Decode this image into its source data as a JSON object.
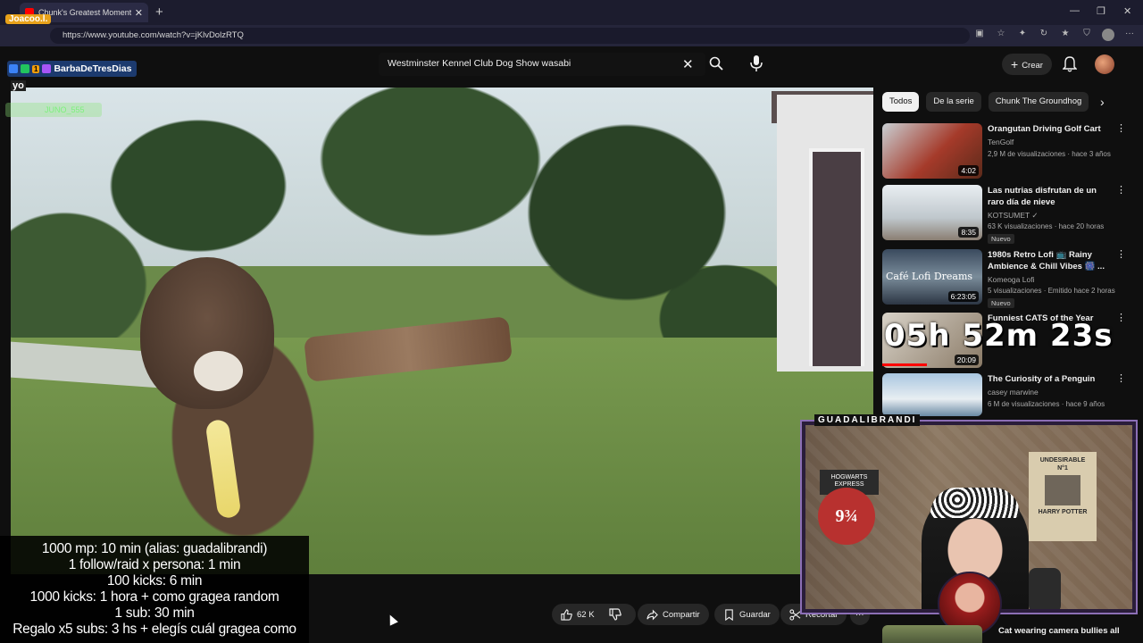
{
  "browser": {
    "tab_title": "Chunk's Greatest Moments Of",
    "tab_close": "✕",
    "new_tab": "+",
    "url": "https://www.youtube.com/watch?v=jKlvDolzRTQ",
    "window_controls": {
      "minimize": "—",
      "restore": "❐",
      "close": "✕"
    }
  },
  "youtube": {
    "search_query": "Westminster Kennel Club Dog Show wasabi",
    "clear_glyph": "✕",
    "create_label": "Crear",
    "create_glyph": "+"
  },
  "chat": {
    "tag": "Joacoo.l.",
    "user": "BarbaDeTresDias",
    "badge_count": "1",
    "short_user": "yo",
    "blurred_user": "JUNO_555"
  },
  "stream_rules": [
    "1000 mp: 10 min (alias: guadalibrandi)",
    "1 follow/raid x persona: 1 min",
    "100 kicks: 6 min",
    "1000 kicks: 1 hora + como gragea random",
    "1 sub: 30 min",
    "Regalo x5 subs: 3 hs + elegís cuál gragea como"
  ],
  "actions": {
    "likes": "62 K",
    "share": "Compartir",
    "save": "Guardar",
    "clip": "Recortar",
    "more": "···"
  },
  "sidebar": {
    "chips": [
      "Todos",
      "De la serie",
      "Chunk The Groundhog"
    ],
    "chips_next": "›",
    "recommendations": [
      {
        "title": "Orangutan Driving Golf Cart",
        "channel": "TenGolf",
        "meta": "2,9 M de visualizaciones · hace 3 años",
        "duration": "4:02",
        "new": ""
      },
      {
        "title": "Las nutrias disfrutan de un raro día de nieve",
        "channel": "KOTSUMET ✓",
        "meta": "63 K visualizaciones · hace 20 horas",
        "duration": "8:35",
        "new": "Nuevo"
      },
      {
        "title": "1980s Retro Lofi 📺 Rainy Ambience & Chill Vibes 🎆 ...",
        "channel": "Komeoga Lofi",
        "meta": "5 visualizaciones · Emitido hace 2 horas",
        "duration": "6:23:05",
        "new": "Nuevo",
        "thumb_text": "Café Lofi Dreams"
      },
      {
        "title": "Funniest CATS of the Year",
        "channel": "",
        "meta": "",
        "duration": "20:09",
        "new": ""
      },
      {
        "title": "The Curiosity of a Penguin",
        "channel": "casey marwine",
        "meta": "6 M de visualizaciones · hace 9 años",
        "duration": "",
        "new": ""
      }
    ],
    "bottom_title": "Cat wearing camera bullies all"
  },
  "overlay": {
    "timer": "05h 52m 23s",
    "cam_label": "GUADALIBRANDI",
    "poster_hogwarts": "HOGWARTS EXPRESS",
    "platform": "9¾",
    "poster_wanted_line1": "UNDESIRABLE",
    "poster_wanted_line2": "N°1",
    "poster_wanted_name": "HARRY POTTER"
  },
  "colors": {
    "yt_bg": "#0f0f0f",
    "accent_red": "#ff0000",
    "chip_active": "#f1f1f1",
    "cam_border": "#8c6fb6"
  }
}
